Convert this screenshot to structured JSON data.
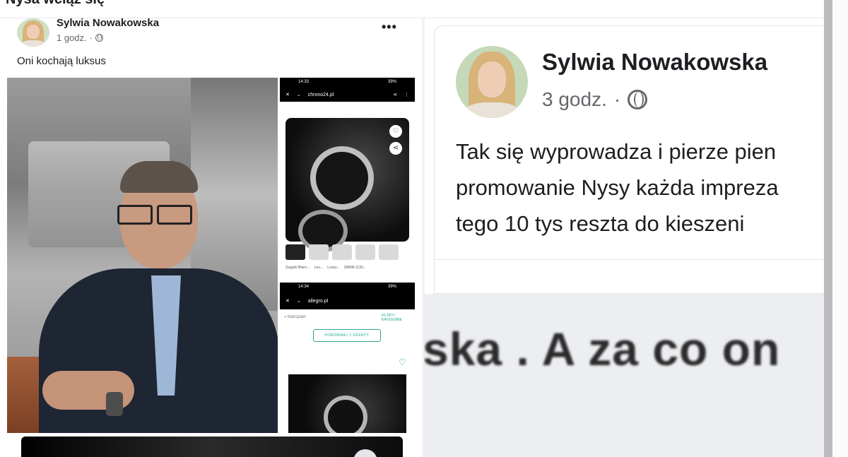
{
  "top_strip": {
    "text": "Nysa wciąż się"
  },
  "left_post": {
    "author": "Sylwia Nowakowska",
    "time": "1 godz.",
    "separator": "·",
    "more_label": "•••",
    "text": "Oni kochają luksus",
    "phone": {
      "status_time_1": "14:33",
      "status_right": "39%",
      "url_1": "chrono24.pl",
      "status_time_2": "14:34",
      "url_2": "allegro.pl",
      "search_placeholder": "blancpain",
      "filters_label": "FILTRY I KATEGORIE",
      "compare_label": "PORÓWNAJ 2 OFERTY",
      "crumbs": [
        "Zegarki Blanc...",
        "Leo...",
        "Luxus...",
        "2880B-1130..."
      ]
    }
  },
  "right_post": {
    "author": "Sylwia Nowakowska",
    "time": "3 godz.",
    "separator": "·",
    "line1": "Tak się wyprowadza i pierze pien",
    "line2": "promowanie Nysy każda impreza",
    "line3": "tego 10 tys reszta do kieszeni"
  },
  "blurred_comment": {
    "text": "ska . A za co on"
  },
  "colors": {
    "accent_teal": "#1aa18c",
    "meta_gray": "#65676b",
    "text": "#1c1e21"
  },
  "icons": [
    "globe-icon",
    "more-icon",
    "favorite-icon",
    "share-icon",
    "heart-icon",
    "search-icon"
  ]
}
